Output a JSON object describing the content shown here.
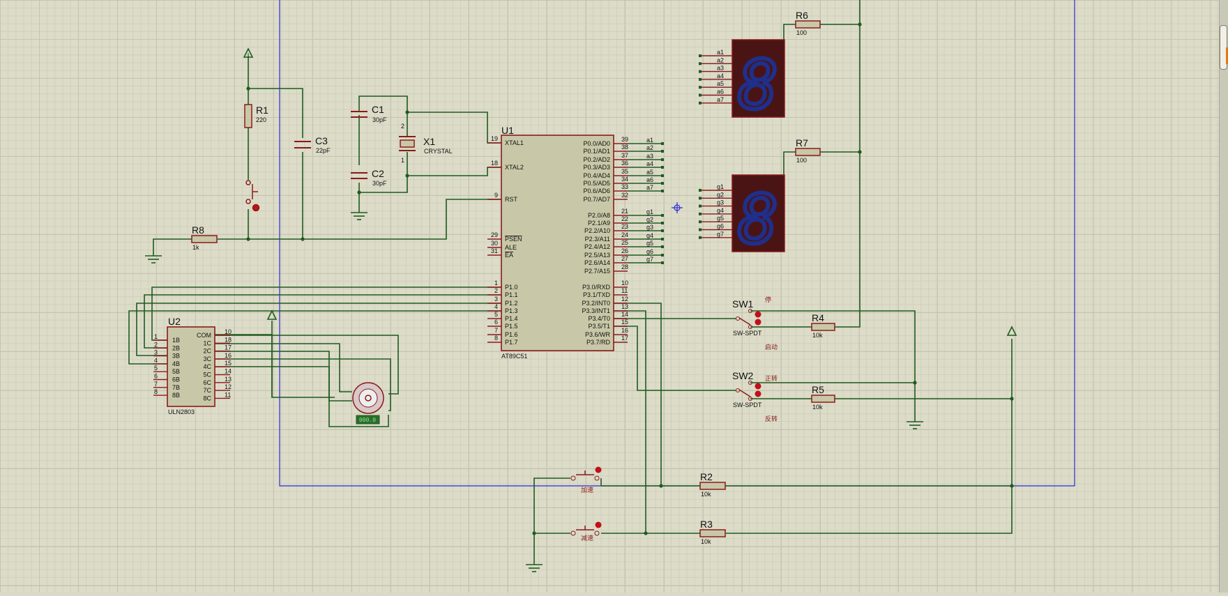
{
  "components": {
    "u1": {
      "ref": "U1",
      "part": "AT89C51",
      "left_pins": [
        {
          "num": "19",
          "name": "XTAL1"
        },
        {
          "num": "18",
          "name": "XTAL2"
        },
        {
          "num": "9",
          "name": "RST"
        },
        {
          "num": "29",
          "name": "PSEN"
        },
        {
          "num": "30",
          "name": "ALE"
        },
        {
          "num": "31",
          "name": "EA"
        },
        {
          "num": "1",
          "name": "P1.0"
        },
        {
          "num": "2",
          "name": "P1.1"
        },
        {
          "num": "3",
          "name": "P1.2"
        },
        {
          "num": "4",
          "name": "P1.3"
        },
        {
          "num": "5",
          "name": "P1.4"
        },
        {
          "num": "6",
          "name": "P1.5"
        },
        {
          "num": "7",
          "name": "P1.6"
        },
        {
          "num": "8",
          "name": "P1.7"
        }
      ],
      "right_pins": [
        {
          "num": "39",
          "name": "P0.0/AD0",
          "net": "a1"
        },
        {
          "num": "38",
          "name": "P0.1/AD1",
          "net": "a2"
        },
        {
          "num": "37",
          "name": "P0.2/AD2",
          "net": "a3"
        },
        {
          "num": "36",
          "name": "P0.3/AD3",
          "net": "a4"
        },
        {
          "num": "35",
          "name": "P0.4/AD4",
          "net": "a5"
        },
        {
          "num": "34",
          "name": "P0.5/AD5",
          "net": "a6"
        },
        {
          "num": "33",
          "name": "P0.6/AD6",
          "net": "a7"
        },
        {
          "num": "32",
          "name": "P0.7/AD7",
          "net": ""
        },
        {
          "num": "21",
          "name": "P2.0/A8",
          "net": "g1"
        },
        {
          "num": "22",
          "name": "P2.1/A9",
          "net": "g2"
        },
        {
          "num": "23",
          "name": "P2.2/A10",
          "net": "g3"
        },
        {
          "num": "24",
          "name": "P2.3/A11",
          "net": "g4"
        },
        {
          "num": "25",
          "name": "P2.4/A12",
          "net": "g5"
        },
        {
          "num": "26",
          "name": "P2.5/A13",
          "net": "g6"
        },
        {
          "num": "27",
          "name": "P2.6/A14",
          "net": "g7"
        },
        {
          "num": "28",
          "name": "P2.7/A15",
          "net": ""
        },
        {
          "num": "10",
          "name": "P3.0/RXD",
          "net": ""
        },
        {
          "num": "11",
          "name": "P3.1/TXD",
          "net": ""
        },
        {
          "num": "12",
          "name": "P3.2/INT0",
          "net": ""
        },
        {
          "num": "13",
          "name": "P3.3/INT1",
          "net": ""
        },
        {
          "num": "14",
          "name": "P3.4/T0",
          "net": ""
        },
        {
          "num": "15",
          "name": "P3.5/T1",
          "net": ""
        },
        {
          "num": "16",
          "name": "P3.6/WR",
          "net": ""
        },
        {
          "num": "17",
          "name": "P3.7/RD",
          "net": ""
        }
      ]
    },
    "u2": {
      "ref": "U2",
      "part": "ULN2803",
      "left_pins": [
        {
          "num": "1",
          "name": "1B"
        },
        {
          "num": "2",
          "name": "2B"
        },
        {
          "num": "3",
          "name": "3B"
        },
        {
          "num": "4",
          "name": "4B"
        },
        {
          "num": "5",
          "name": "5B"
        },
        {
          "num": "6",
          "name": "6B"
        },
        {
          "num": "7",
          "name": "7B"
        },
        {
          "num": "8",
          "name": "8B"
        }
      ],
      "right_pins": [
        {
          "num": "10",
          "name": "COM"
        },
        {
          "num": "18",
          "name": "1C"
        },
        {
          "num": "17",
          "name": "2C"
        },
        {
          "num": "16",
          "name": "3C"
        },
        {
          "num": "15",
          "name": "4C"
        },
        {
          "num": "14",
          "name": "5C"
        },
        {
          "num": "13",
          "name": "6C"
        },
        {
          "num": "12",
          "name": "7C"
        },
        {
          "num": "11",
          "name": "8C"
        }
      ]
    },
    "r1": {
      "ref": "R1",
      "value": "220"
    },
    "r2": {
      "ref": "R2",
      "value": "10k"
    },
    "r3": {
      "ref": "R3",
      "value": "10k"
    },
    "r4": {
      "ref": "R4",
      "value": "10k"
    },
    "r5": {
      "ref": "R5",
      "value": "10k"
    },
    "r6": {
      "ref": "R6",
      "value": "100"
    },
    "r7": {
      "ref": "R7",
      "value": "100"
    },
    "r8": {
      "ref": "R8",
      "value": "1k"
    },
    "c1": {
      "ref": "C1",
      "value": "30pF"
    },
    "c2": {
      "ref": "C2",
      "value": "30pF"
    },
    "c3": {
      "ref": "C3",
      "value": "22pF"
    },
    "x1": {
      "ref": "X1",
      "value": "CRYSTAL",
      "pin1": "1",
      "pin2": "2"
    },
    "sw1": {
      "ref": "SW1",
      "part": "SW-SPDT",
      "label_top": "停",
      "label_bottom": "启动"
    },
    "sw2": {
      "ref": "SW2",
      "part": "SW-SPDT",
      "label_top": "正转",
      "label_bottom": "反转"
    },
    "btn_up": {
      "label": "加速"
    },
    "btn_down": {
      "label": "减速"
    },
    "motor": {
      "readout": "000.0"
    },
    "display1": {
      "digit": "8",
      "nets": [
        "a1",
        "a2",
        "a3",
        "a4",
        "a5",
        "a6",
        "a7"
      ]
    },
    "display2": {
      "digit": "8",
      "nets": [
        "g1",
        "g2",
        "g3",
        "g4",
        "g5",
        "g6",
        "g7"
      ]
    }
  },
  "colors": {
    "wire": "#1f5a1f",
    "component": "#8b1a1a",
    "body_fill": "#c8c8a8",
    "sheet_border": "#2b2bd6",
    "display_bg": "#4a1414",
    "segment": "#1f2f8a"
  }
}
